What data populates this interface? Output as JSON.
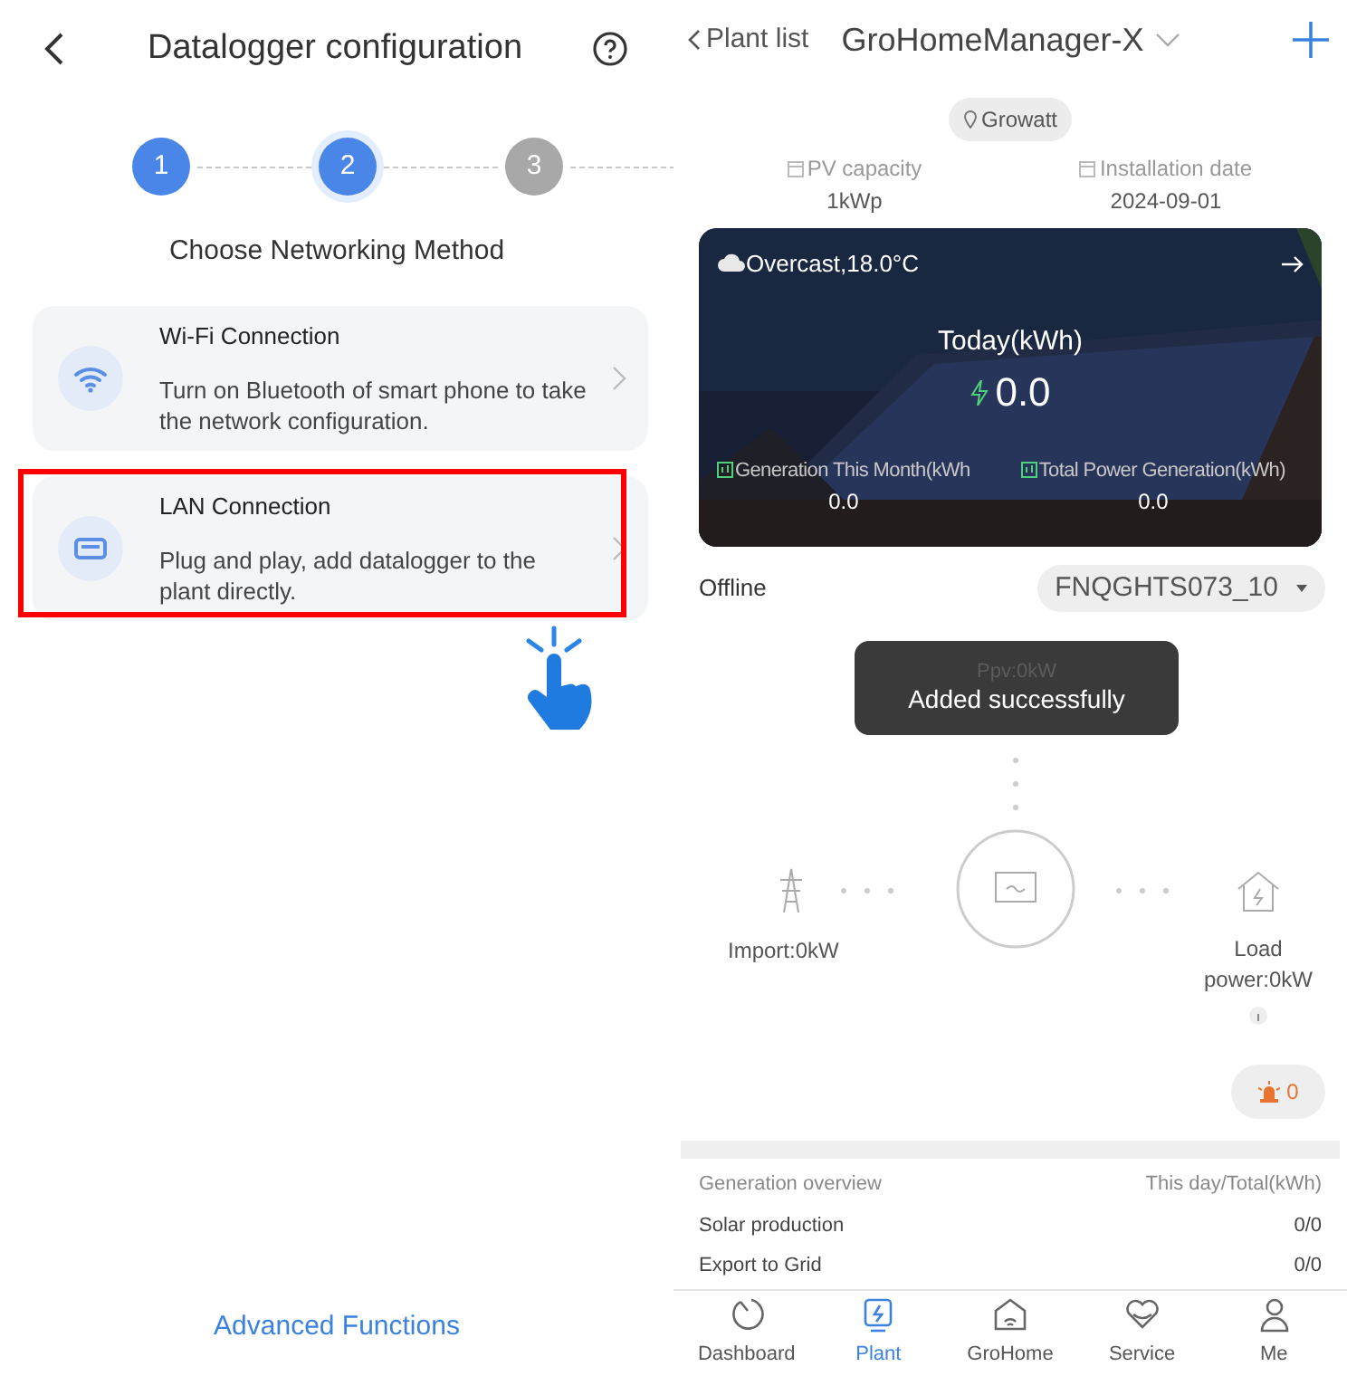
{
  "config_screen": {
    "title": "Datalogger configuration",
    "steps": [
      {
        "label": "1",
        "completed": true,
        "selected": false
      },
      {
        "label": "2",
        "completed": true,
        "selected": true
      },
      {
        "label": "3",
        "completed": false,
        "selected": false
      }
    ],
    "subtitle": "Choose Networking Method",
    "options": [
      {
        "kind": "wifi",
        "title": "Wi-Fi Connection",
        "description": "Turn on Bluetooth of smart phone to take the network configuration.",
        "highlighted": false
      },
      {
        "kind": "lan",
        "title": "LAN Connection",
        "description": "Plug and play, add datalogger to the plant directly.",
        "highlighted": true
      }
    ],
    "footer_link": "Advanced Functions"
  },
  "plant_screen": {
    "back_label": "Plant list",
    "title": "GroHomeManager-X",
    "location": "Growatt",
    "stats": [
      {
        "label": "PV capacity",
        "value": "1kWp"
      },
      {
        "label": "Installation date",
        "value": "2024-09-01"
      }
    ],
    "banner": {
      "weather": "Overcast,18.0°C",
      "today_label": "Today(kWh)",
      "today_value": "0.0",
      "totals": [
        {
          "label": "Generation This Month(kWh",
          "value": "0.0"
        },
        {
          "label": "Total Power Generation(kWh)",
          "value": "0.0"
        }
      ]
    },
    "status": "Offline",
    "device": "FNQGHTS073_10",
    "flow": {
      "ppv": "Ppv:0kW",
      "import": "Import:0kW",
      "load": "Load power:0kW"
    },
    "toast": "Added successfully",
    "alarm_count": "0",
    "overview": {
      "title": "Generation overview",
      "unit": "This day/Total(kWh)",
      "rows": [
        {
          "label": "Solar production",
          "value": "0/0"
        },
        {
          "label": "Export to Grid",
          "value": "0/0"
        }
      ]
    },
    "tabs": [
      {
        "label": "Dashboard",
        "selected": false
      },
      {
        "label": "Plant",
        "selected": true
      },
      {
        "label": "GroHome",
        "selected": false
      },
      {
        "label": "Service",
        "selected": false
      },
      {
        "label": "Me",
        "selected": false
      }
    ]
  }
}
